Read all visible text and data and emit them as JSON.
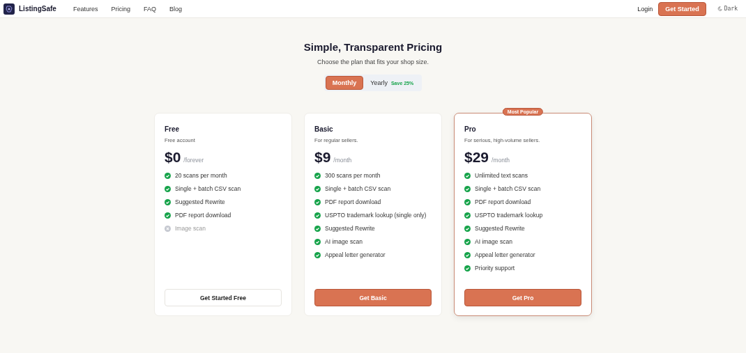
{
  "nav": {
    "brand": "ListingSafe",
    "links": [
      "Features",
      "Pricing",
      "FAQ",
      "Blog"
    ],
    "login": "Login",
    "cta": "Get Started",
    "theme_toggle": "Dark"
  },
  "hero": {
    "title": "Simple, Transparent Pricing",
    "subtitle": "Choose the plan that fits your shop size."
  },
  "billing": [
    {
      "label": "Monthly",
      "selected": true
    },
    {
      "label": "Yearly",
      "note": "Save 25%",
      "selected": false
    }
  ],
  "plans": [
    {
      "name": "Free",
      "description": "Free account",
      "price": "$0",
      "period": "/forever",
      "featured": false,
      "features": [
        {
          "text": "20 scans per month",
          "included": true
        },
        {
          "text": "Single + batch CSV scan",
          "included": true
        },
        {
          "text": "Suggested Rewrite",
          "included": true
        },
        {
          "text": "PDF report download",
          "included": true
        },
        {
          "text": "Image scan",
          "included": false
        }
      ],
      "button": {
        "label": "Get Started Free",
        "primary": false
      }
    },
    {
      "name": "Basic",
      "description": "For regular sellers.",
      "price": "$9",
      "period": "/month",
      "featured": false,
      "features": [
        {
          "text": "300 scans per month",
          "included": true
        },
        {
          "text": "Single + batch CSV scan",
          "included": true
        },
        {
          "text": "PDF report download",
          "included": true
        },
        {
          "text": "USPTO trademark lookup (single only)",
          "included": true
        },
        {
          "text": "Suggested Rewrite",
          "included": true
        },
        {
          "text": "AI image scan",
          "included": true
        },
        {
          "text": "Appeal letter generator",
          "included": true
        }
      ],
      "button": {
        "label": "Get Basic",
        "primary": true
      }
    },
    {
      "name": "Pro",
      "description": "For serious, high-volume sellers.",
      "price": "$29",
      "period": "/month",
      "featured": true,
      "badge": "Most Popular",
      "features": [
        {
          "text": "Unlimited text scans",
          "included": true
        },
        {
          "text": "Single + batch CSV scan",
          "included": true
        },
        {
          "text": "PDF report download",
          "included": true
        },
        {
          "text": "USPTO trademark lookup",
          "included": true
        },
        {
          "text": "Suggested Rewrite",
          "included": true
        },
        {
          "text": "AI image scan",
          "included": true
        },
        {
          "text": "Appeal letter generator",
          "included": true
        },
        {
          "text": "Priority support",
          "included": true
        }
      ],
      "button": {
        "label": "Get Pro",
        "primary": true
      }
    }
  ]
}
